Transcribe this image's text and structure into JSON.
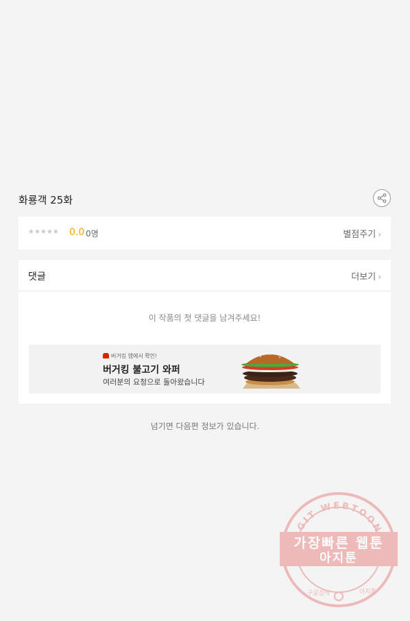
{
  "episode": {
    "title": "화룡객 25화"
  },
  "rating": {
    "stars": "★★★★★",
    "score": "0.0",
    "count": "0명",
    "rate_label": "별점주기"
  },
  "comments": {
    "title": "댓글",
    "more_label": "더보기",
    "empty_message": "이 작품의 첫 댓글을 남겨주세요!"
  },
  "ad": {
    "brand": "버거킹 앱에서 확인!",
    "title": "버거킹 불고기 와퍼",
    "subtitle": "여러분의 요청으로 돌아왔습니다"
  },
  "footer": {
    "next_info": "넘기면 다음편 정보가 있습니다."
  },
  "watermark": {
    "ring_text": "AGIT WEBTOON",
    "line1": "가장빠른 웹툰",
    "line2": "아지툰",
    "bottom_left": "구글검색",
    "bottom_right": "아지툰"
  },
  "colors": {
    "background": "#f4f4f4",
    "score": "#f5a300",
    "watermark": "#e88a8a"
  }
}
